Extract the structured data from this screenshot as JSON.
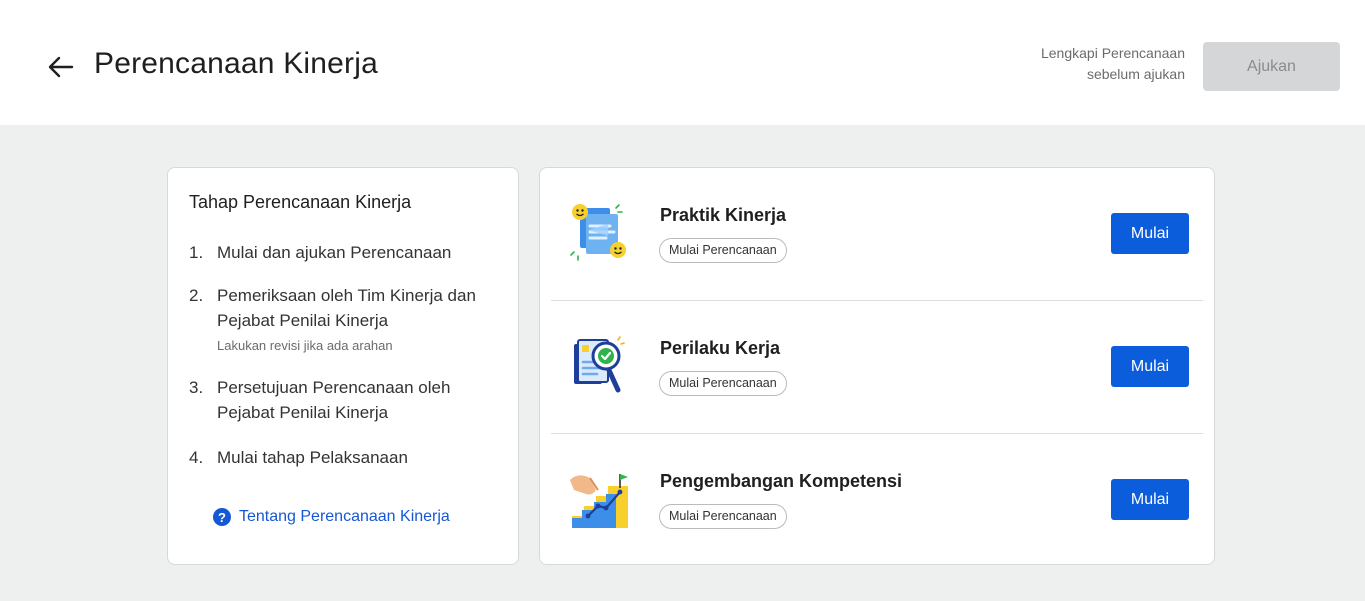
{
  "header": {
    "title": "Perencanaan Kinerja",
    "hint_line1": "Lengkapi Perencanaan",
    "hint_line2": "sebelum ajukan",
    "submit_label": "Ajukan"
  },
  "steps": {
    "title": "Tahap Perencanaan Kinerja",
    "items": [
      {
        "num": "1.",
        "text": "Mulai dan ajukan Perencanaan",
        "sub": ""
      },
      {
        "num": "2.",
        "text": "Pemeriksaan oleh Tim Kinerja dan Pejabat Penilai Kinerja",
        "sub": "Lakukan revisi jika ada arahan"
      },
      {
        "num": "3.",
        "text": "Persetujuan Perencanaan oleh Pejabat Penilai Kinerja",
        "sub": ""
      },
      {
        "num": "4.",
        "text": "Mulai tahap Pelaksanaan",
        "sub": ""
      }
    ],
    "about_link": "Tentang Perencanaan Kinerja",
    "about_icon": "?"
  },
  "tasks": [
    {
      "title": "Praktik Kinerja",
      "status": "Mulai Perencanaan",
      "button": "Mulai",
      "icon": "documents-smiley-illustration"
    },
    {
      "title": "Perilaku Kerja",
      "status": "Mulai Perencanaan",
      "button": "Mulai",
      "icon": "magnifier-check-illustration"
    },
    {
      "title": "Pengembangan Kompetensi",
      "status": "Mulai Perencanaan",
      "button": "Mulai",
      "icon": "stairs-growth-illustration"
    }
  ],
  "colors": {
    "primary": "#0b5ddb",
    "link": "#1558d6",
    "background": "#eef0f0",
    "disabled_button": "#d4d6d8"
  }
}
